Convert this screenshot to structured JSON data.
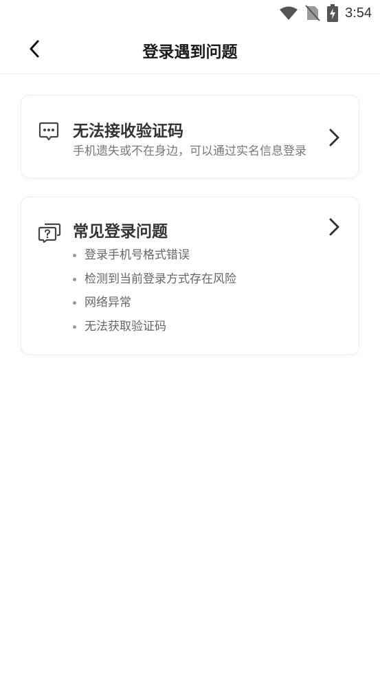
{
  "status_bar": {
    "time": "3:54",
    "icons": [
      "wifi-icon",
      "no-sim-icon",
      "battery-charging-icon"
    ]
  },
  "header": {
    "title": "登录遇到问题",
    "back_icon": "chevron-left-icon"
  },
  "cards": [
    {
      "icon": "chat-dots-icon",
      "title": "无法接收验证码",
      "description": "手机遗失或不在身边，可以通过实名信息登录"
    },
    {
      "icon": "question-chat-icon",
      "title": "常见登录问题",
      "items": [
        "登录手机号格式错误",
        "检测到当前登录方式存在风险",
        "网络异常",
        "无法获取验证码"
      ]
    }
  ],
  "colors": {
    "background": "#ffffff",
    "title": "#333333",
    "description": "#777777"
  }
}
